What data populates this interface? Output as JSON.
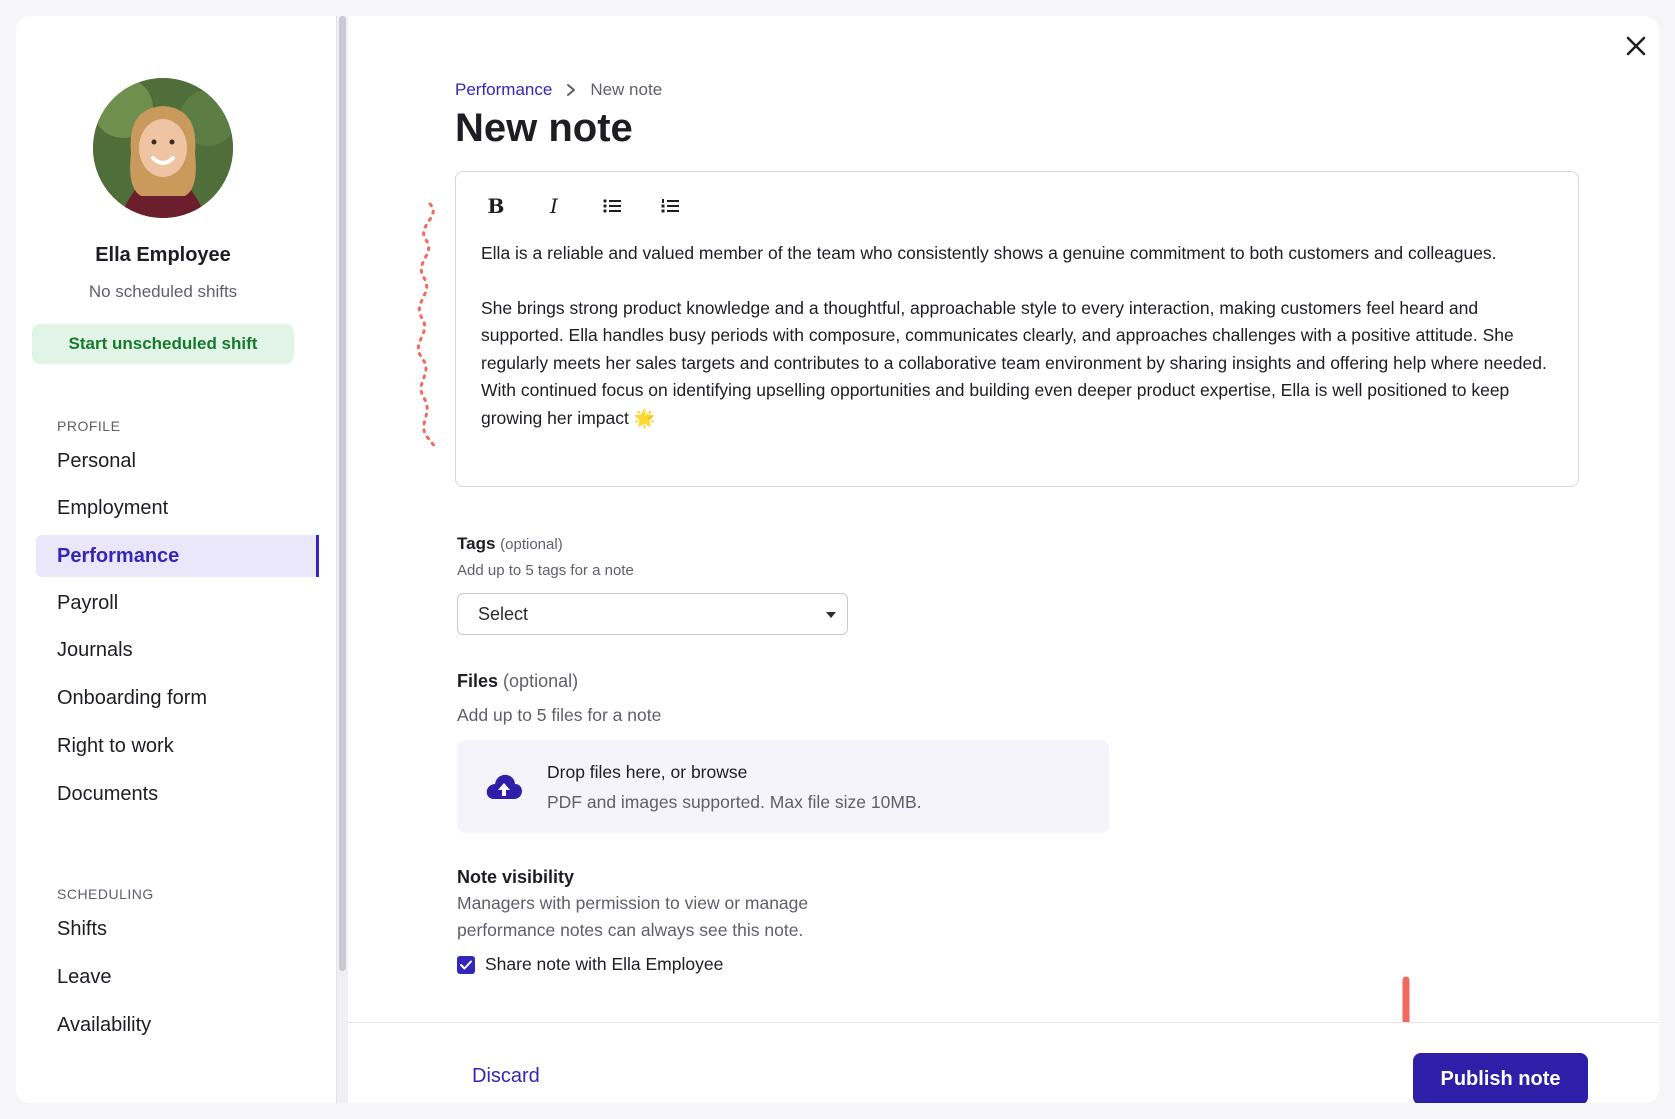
{
  "employee": {
    "name": "Ella Employee",
    "shift_status": "No scheduled shifts",
    "start_shift_label": "Start unscheduled shift"
  },
  "sidebar": {
    "profile_section": "PROFILE",
    "profile_items": [
      {
        "label": "Personal"
      },
      {
        "label": "Employment"
      },
      {
        "label": "Performance",
        "active": true
      },
      {
        "label": "Payroll"
      },
      {
        "label": "Journals"
      },
      {
        "label": "Onboarding form"
      },
      {
        "label": "Right to work"
      },
      {
        "label": "Documents"
      }
    ],
    "scheduling_section": "SCHEDULING",
    "scheduling_items": [
      {
        "label": "Shifts"
      },
      {
        "label": "Leave"
      },
      {
        "label": "Availability"
      }
    ]
  },
  "breadcrumb": {
    "parent": "Performance",
    "current": "New note"
  },
  "page_title": "New note",
  "editor": {
    "toolbar": {
      "bold": "B",
      "italic": "I"
    },
    "paragraph_1": "Ella is a reliable and valued member of the team who consistently shows a genuine commitment to both customers and colleagues.",
    "paragraph_2": "She brings strong product knowledge and a thoughtful, approachable style to every interaction, making customers feel heard and supported. Ella handles busy periods with composure, communicates clearly, and approaches challenges with a positive attitude. She regularly meets her sales targets and contributes to a collaborative team environment by sharing insights and offering help where needed. With continued focus on identifying upselling opportunities and building even deeper product expertise, Ella is well positioned to keep growing her impact 🌟"
  },
  "tags": {
    "label": "Tags",
    "optional": "(optional)",
    "help": "Add up to 5 tags for a note",
    "select_value": "Select"
  },
  "files": {
    "label": "Files",
    "optional": "(optional)",
    "help": "Add up to 5 files for a note",
    "drop_title": "Drop files here, or browse",
    "drop_sub": "PDF and images supported. Max file size 10MB."
  },
  "visibility": {
    "label": "Note visibility",
    "description": "Managers with permission to view or manage performance notes can always see this note.",
    "checkbox_label": "Share note with Ella Employee",
    "checked": true
  },
  "footer": {
    "discard_label": "Discard",
    "publish_label": "Publish note"
  },
  "colors": {
    "accent": "#3426b8",
    "publish_bg": "#2e1ea8",
    "start_shift_bg": "#e2f4e6",
    "start_shift_text": "#157a2e",
    "annotation": "#f06a5e"
  }
}
